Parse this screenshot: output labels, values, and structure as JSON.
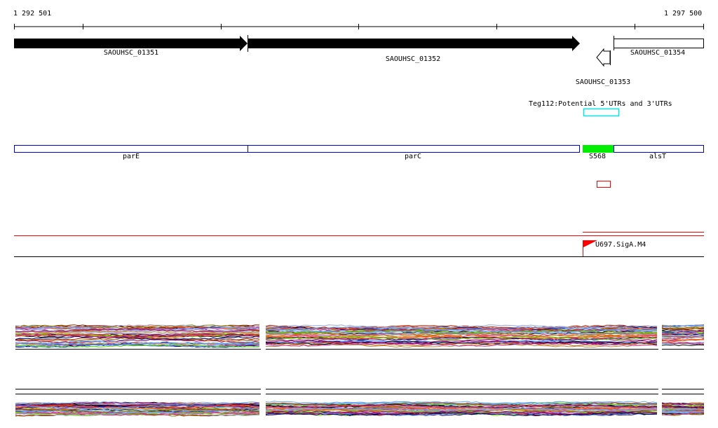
{
  "ruler": {
    "start_label": "1 292 501",
    "end_label": "1 297 500"
  },
  "genes": [
    {
      "name": "SAOUHSC_01351",
      "strand": "+"
    },
    {
      "name": "SAOUHSC_01352",
      "strand": "+"
    },
    {
      "name": "SAOUHSC_01353",
      "strand": "-"
    },
    {
      "name": "SAOUHSC_01354",
      "strand": "none"
    }
  ],
  "utr_track": {
    "label": "Teg112:Potential 5'UTRs and 3'UTRs",
    "color": "#00e5ee"
  },
  "annotation_track": [
    {
      "name": "parE",
      "color": "#0000cc"
    },
    {
      "name": "parC",
      "color": "#0000cc"
    },
    {
      "name": "S568",
      "color": "#00ee00"
    },
    {
      "name": "alsT",
      "color": "#0000cc"
    }
  ],
  "promoter": {
    "label": "U697.SigA.M4",
    "color": "#ff0000"
  },
  "colors": {
    "feature_red": "#ff0000"
  }
}
